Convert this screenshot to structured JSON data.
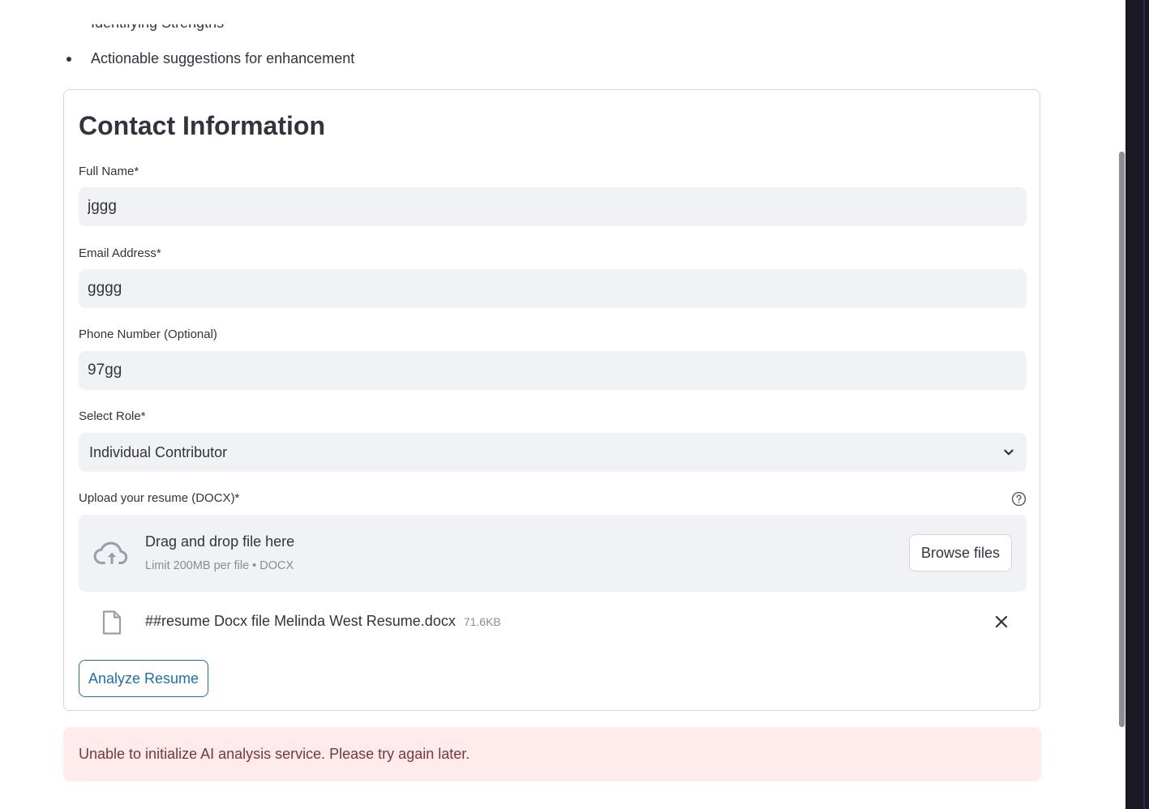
{
  "intro": {
    "partial_line": "Identifying Strengths",
    "bullet": "Actionable suggestions for enhancement"
  },
  "form": {
    "title": "Contact Information",
    "full_name": {
      "label": "Full Name*",
      "value": "jggg"
    },
    "email": {
      "label": "Email Address*",
      "value": "gggg"
    },
    "phone": {
      "label": "Phone Number (Optional)",
      "value": "97gg"
    },
    "role": {
      "label": "Select Role*",
      "selected": "Individual Contributor"
    },
    "upload": {
      "label": "Upload your resume (DOCX)*",
      "dropzone_title": "Drag and drop file here",
      "dropzone_limit": "Limit 200MB per file • DOCX",
      "browse_label": "Browse files",
      "file_name": "##resume Docx file Melinda West Resume.docx",
      "file_size": "71.6KB"
    },
    "analyze_label": "Analyze Resume"
  },
  "error": {
    "message": "Unable to initialize AI analysis service. Please try again later."
  },
  "colors": {
    "accent": "#1f6fb3",
    "input_bg": "#f0f2f6",
    "error_bg": "#ffebec",
    "error_text": "#7d353b"
  }
}
